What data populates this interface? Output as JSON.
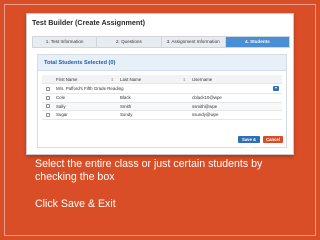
{
  "app": {
    "title": "Test Builder (Create Assignment)"
  },
  "tabs": [
    {
      "label": "1. Test Information",
      "active": false
    },
    {
      "label": "2. Questions",
      "active": false
    },
    {
      "label": "3. Assignment Information",
      "active": false
    },
    {
      "label": "4. Students",
      "active": true
    }
  ],
  "panel": {
    "header": "Total Students Selected (0)"
  },
  "table": {
    "columns": [
      "First Name",
      "Last Name",
      "Username"
    ],
    "class_row": "Mrs. Pafford's Fifth Grade Reading",
    "rows": [
      {
        "first": "Cole",
        "last": "Black",
        "username": "cblack10@wpe"
      },
      {
        "first": "Sally",
        "last": "Smith",
        "username": "ssmith@wpe"
      },
      {
        "first": "Sugar",
        "last": "Sundy",
        "username": "ssundy@wpe"
      }
    ]
  },
  "buttons": {
    "save": "Save & Exit",
    "cancel": "Cancel"
  },
  "captions": {
    "line1": "Select the entire class or just certain students by",
    "line2": "checking the box",
    "line3": "Click Save & Exit"
  },
  "colors": {
    "background": "#d94e27",
    "accent": "#2f6fb6",
    "active_tab": "#4a8fd6"
  }
}
